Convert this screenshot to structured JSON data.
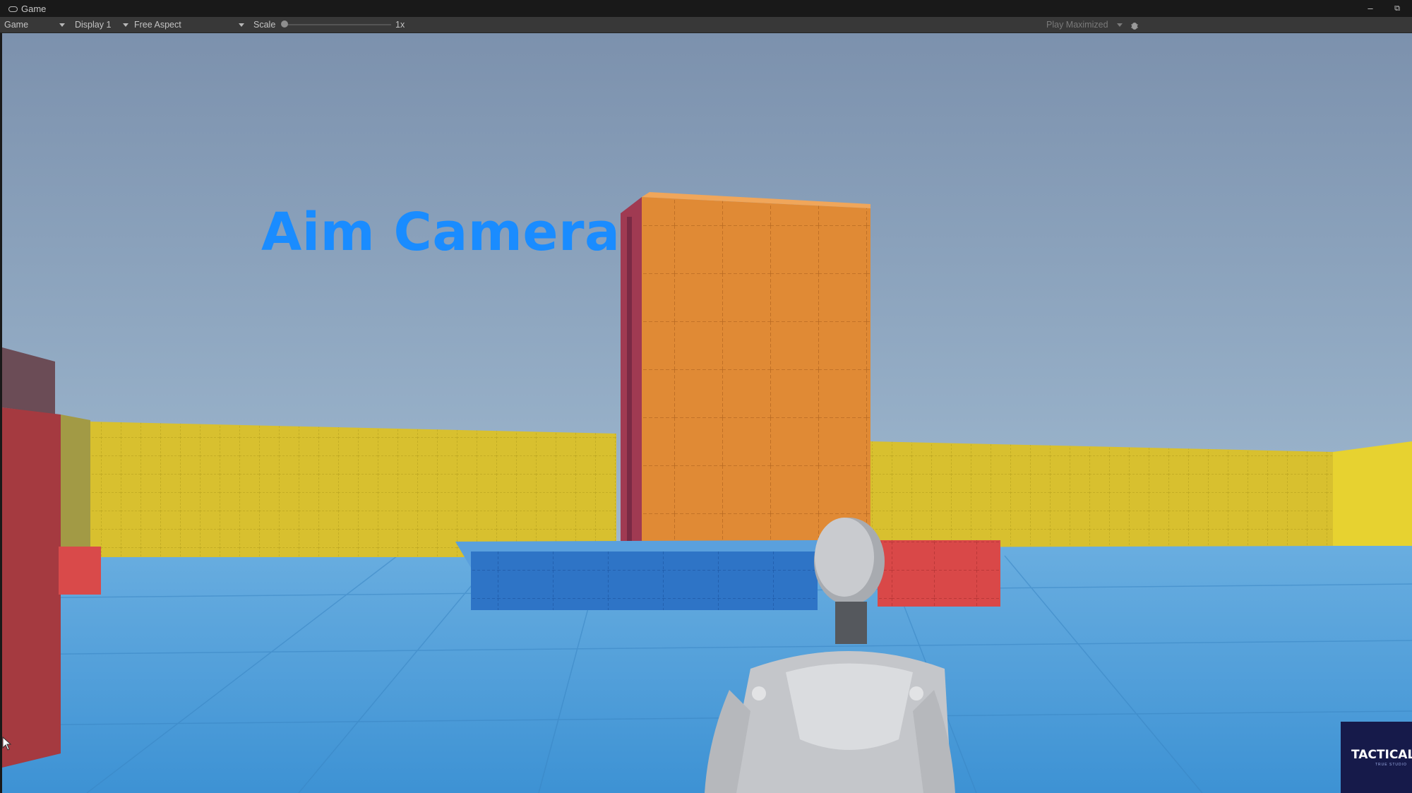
{
  "window": {
    "tab_title": "Game",
    "tab_icon": "gamepad-icon",
    "minimize_glyph": "–",
    "maximize_glyph": "⧉"
  },
  "toolbar": {
    "view_mode": "Game",
    "display": "Display 1",
    "aspect": "Free Aspect",
    "scale_label": "Scale",
    "scale_value": "1x",
    "play_mode": "Play Maximized",
    "stats_icon": "bug-icon"
  },
  "viewport": {
    "overlay_title": "Aim Camera",
    "overlay_color": "#1a8cff"
  },
  "watermark": {
    "logo_text": "TACTICAL",
    "logo_subtext": "TRUE STUDIO",
    "background": "#161a4a"
  },
  "colors": {
    "sky_top": "#7d92ae",
    "sky_bottom": "#a9c4dc",
    "floor": "#4c9ed8",
    "yellow_wall": "#d6be2e",
    "orange_tower": "#df8b36",
    "blue_block": "#2f76c8",
    "red_block": "#d84646",
    "maroon_block": "#a23a44"
  }
}
